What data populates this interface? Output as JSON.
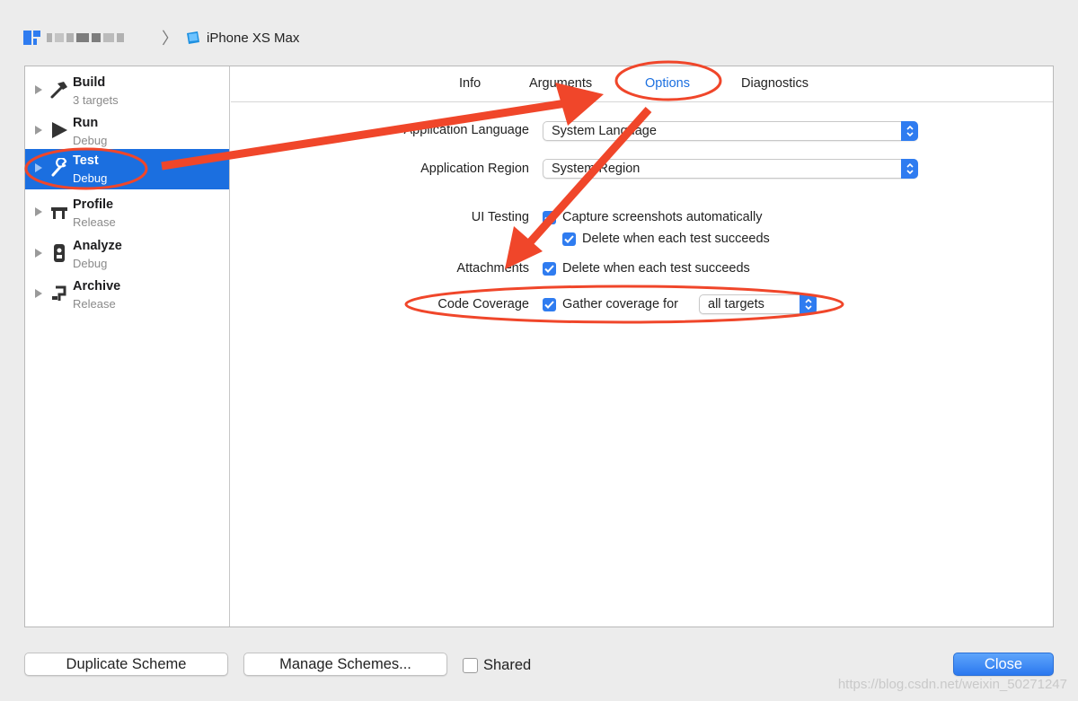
{
  "titlebar": {
    "device": "iPhone XS Max"
  },
  "sidebar": {
    "items": [
      {
        "title": "Build",
        "subtitle": "3 targets",
        "icon": "hammer-icon"
      },
      {
        "title": "Run",
        "subtitle": "Debug",
        "icon": "play-icon"
      },
      {
        "title": "Test",
        "subtitle": "Debug",
        "icon": "wrench-icon",
        "selected": true
      },
      {
        "title": "Profile",
        "subtitle": "Release",
        "icon": "caliper-icon"
      },
      {
        "title": "Analyze",
        "subtitle": "Debug",
        "icon": "analyze-icon"
      },
      {
        "title": "Archive",
        "subtitle": "Release",
        "icon": "archive-icon"
      }
    ]
  },
  "tabs": [
    {
      "label": "Info"
    },
    {
      "label": "Arguments"
    },
    {
      "label": "Options",
      "active": true
    },
    {
      "label": "Diagnostics"
    }
  ],
  "options": {
    "app_language_label": "Application Language",
    "app_language_value": "System Language",
    "app_region_label": "Application Region",
    "app_region_value": "System Region",
    "ui_testing_label": "UI Testing",
    "capture_screenshots": "Capture screenshots automatically",
    "delete_screenshots": "Delete when each test succeeds",
    "attachments_label": "Attachments",
    "delete_attachments": "Delete when each test succeeds",
    "code_coverage_label": "Code Coverage",
    "gather_coverage": "Gather coverage for",
    "coverage_targets_value": "all targets"
  },
  "footer": {
    "duplicate_label": "Duplicate Scheme",
    "manage_label": "Manage Schemes...",
    "shared_label": "Shared",
    "close_label": "Close",
    "watermark": "https://blog.csdn.net/weixin_50271247"
  },
  "colors": {
    "accent": "#1b6fe0",
    "annotation": "#f0462a"
  }
}
